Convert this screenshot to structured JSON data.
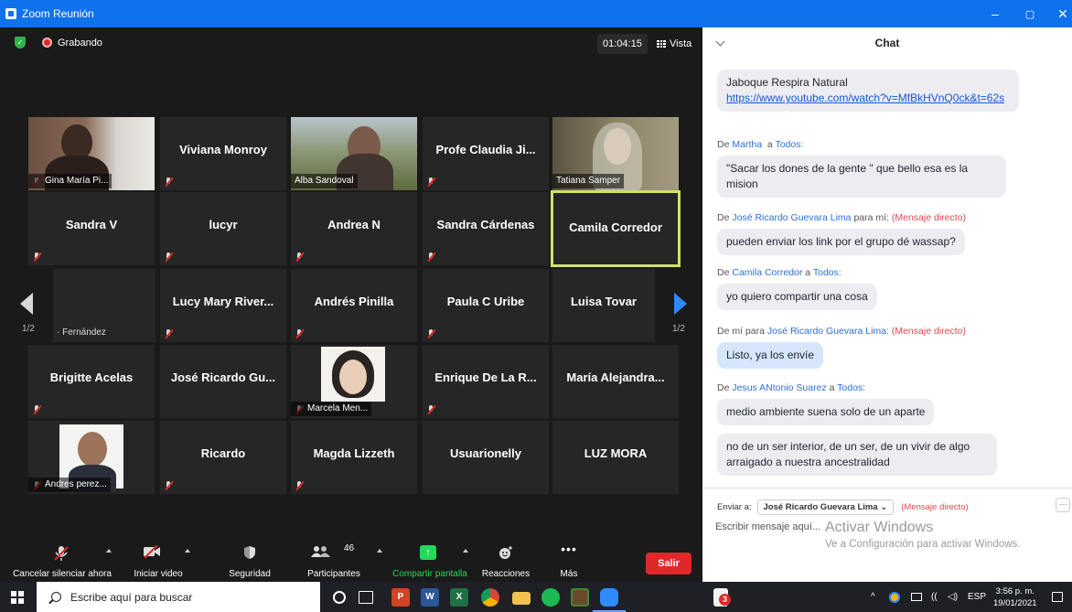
{
  "window": {
    "title": "Zoom Reunión",
    "controls": [
      "–",
      "▢",
      "✕"
    ]
  },
  "meeting": {
    "recording_label": "Grabando",
    "timer": "01:04:15",
    "view_label": "Vista",
    "page_left": "1/2",
    "page_right": "1/2",
    "participants": [
      {
        "name": "Gina María Pi...",
        "has_video": true
      },
      {
        "name": "Viviana Monroy",
        "has_video": false
      },
      {
        "name": "Alba Sandoval",
        "has_video": true
      },
      {
        "name": "Profe Claudia Ji...",
        "has_video": false
      },
      {
        "name": "Tatiana Samper",
        "has_video": true
      },
      {
        "name": "Sandra V",
        "has_video": false
      },
      {
        "name": "lucyr",
        "has_video": false
      },
      {
        "name": "Andrea N",
        "has_video": false
      },
      {
        "name": "Sandra Cárdenas",
        "has_video": false
      },
      {
        "name": "Camila Corredor",
        "has_video": false,
        "active": true
      },
      {
        "name": "· Fernández",
        "has_video": false
      },
      {
        "name": "Lucy Mary River...",
        "has_video": false
      },
      {
        "name": "Andrés Pinilla",
        "has_video": false
      },
      {
        "name": "Paula C Uribe",
        "has_video": false
      },
      {
        "name": "Luisa Tovar",
        "has_video": false
      },
      {
        "name": "Brigitte Acelas",
        "has_video": false
      },
      {
        "name": "José Ricardo Gu...",
        "has_video": false
      },
      {
        "name": "Marcela Men...",
        "has_video": true
      },
      {
        "name": "Enrique De La R...",
        "has_video": false
      },
      {
        "name": "María Alejandra...",
        "has_video": false
      },
      {
        "name": "Andres perez...",
        "has_video": true
      },
      {
        "name": "Ricardo",
        "has_video": false
      },
      {
        "name": "Magda Lizzeth",
        "has_video": false
      },
      {
        "name": "Usuarionelly",
        "has_video": false
      },
      {
        "name": "LUZ MORA",
        "has_video": false
      }
    ],
    "toolbar": {
      "mute": "Cancelar silenciar ahora",
      "video": "Iniciar video",
      "security": "Seguridad",
      "participants": "Participantes",
      "participants_count": "46",
      "share": "Compartir pantalla",
      "reactions": "Reacciones",
      "more": "Más",
      "leave": "Salir"
    },
    "colors": {
      "share_green": "#23d959",
      "leave_red": "#e02828",
      "active_border": "#cfe168"
    }
  },
  "chat": {
    "title": "Chat",
    "messages": [
      {
        "sender": "",
        "text": "Jaboque Respira Natural",
        "link": "https://www.youtube.com/watch?v=MfBkHVnQ0ck&t=62s"
      },
      {
        "prefix": "De",
        "from": "Martha",
        "to": "Todos:",
        "text": "\"Sacar los dones de la gente \" que bello esa es la mision"
      },
      {
        "prefix": "De",
        "from": "José Ricardo Guevara Lima",
        "to_plain": "para mí:",
        "dm": "(Mensaje directo)",
        "text": "pueden enviar los link por el grupo dé wassap?"
      },
      {
        "prefix": "De",
        "from": "Camila Corredor",
        "to": "Todos:",
        "text": "yo quiero compartir una cosa"
      },
      {
        "prefix": "De mí para",
        "from": "José Ricardo Guevara Lima:",
        "dm": "(Mensaje directo)",
        "text": "Listo, ya los envíe"
      },
      {
        "prefix": "De",
        "from": "Jesus ANtonio Suarez",
        "to": "Todos:",
        "text": "medio ambiente suena solo de un aparte"
      },
      {
        "text": "no de un ser interior, de un ser, de un vivir de algo arraigado a nuestra ancestralidad"
      }
    ],
    "send_to_label": "Enviar a:",
    "send_to_value": "José Ricardo Guevara Lima ⌄",
    "send_to_dm": "(Mensaje directo)",
    "more": "···",
    "input_placeholder": "Escribir mensaje aquí...",
    "watermark_line1": "Activar Windows",
    "watermark_line2": "Ve a Configuración para activar Windows."
  },
  "taskbar": {
    "search_placeholder": "Escribe aquí para buscar",
    "apps": [
      "cortana",
      "task-view",
      "powerpoint",
      "word",
      "excel",
      "chrome",
      "explorer",
      "spotify",
      "minecraft",
      "zoom",
      "acrobat"
    ],
    "app_letters": {
      "powerpoint": "P",
      "word": "W",
      "excel": "X"
    },
    "acrobat_badge": "3",
    "tray_caret": "^",
    "tray_wifi": "((",
    "tray_speaker": "◁)",
    "lang": "ESP",
    "time": "3:56 p. m.",
    "date": "19/01/2021"
  }
}
